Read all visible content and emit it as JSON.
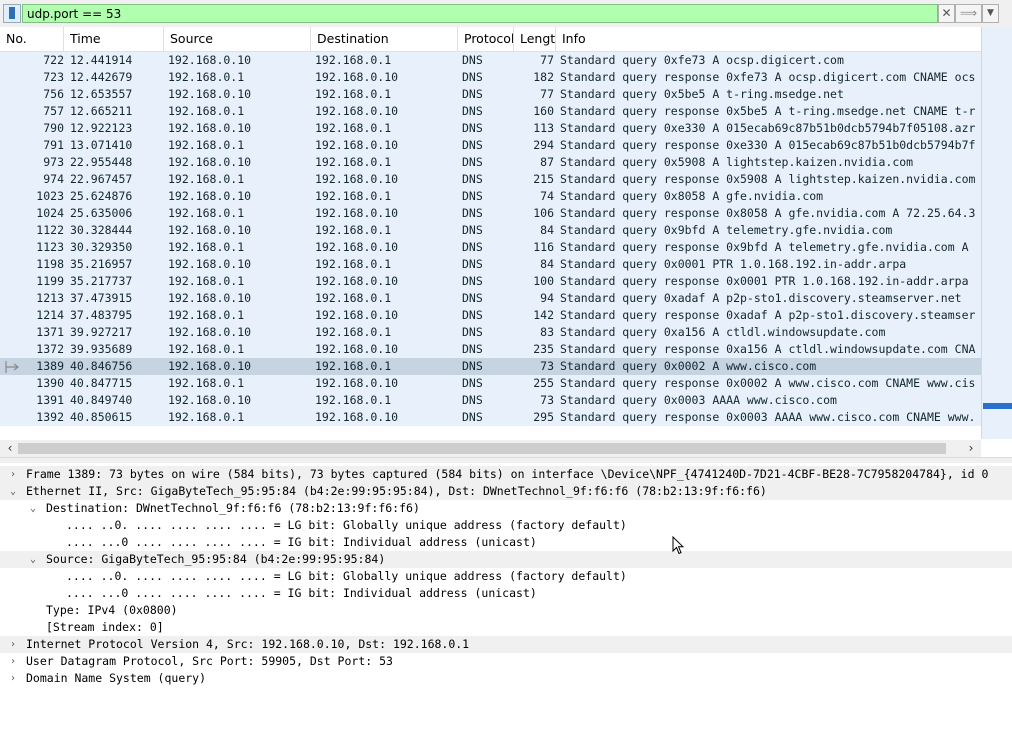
{
  "filter": {
    "value": "udp.port == 53",
    "clear_glyph": "✕",
    "apply_glyph": "⟹",
    "recent_glyph": "▼"
  },
  "packet_list": {
    "columns": [
      "No.",
      "Time",
      "Source",
      "Destination",
      "Protocol",
      "Lengtl",
      "Info"
    ],
    "selected_no": "1389",
    "rows": [
      {
        "no": "722",
        "time": "12.441914",
        "src": "192.168.0.10",
        "dst": "192.168.0.1",
        "proto": "DNS",
        "len": "77",
        "info": "Standard query 0xfe73 A ocsp.digicert.com"
      },
      {
        "no": "723",
        "time": "12.442679",
        "src": "192.168.0.1",
        "dst": "192.168.0.10",
        "proto": "DNS",
        "len": "182",
        "info": "Standard query response 0xfe73 A ocsp.digicert.com CNAME ocs"
      },
      {
        "no": "756",
        "time": "12.653557",
        "src": "192.168.0.10",
        "dst": "192.168.0.1",
        "proto": "DNS",
        "len": "77",
        "info": "Standard query 0x5be5 A t-ring.msedge.net"
      },
      {
        "no": "757",
        "time": "12.665211",
        "src": "192.168.0.1",
        "dst": "192.168.0.10",
        "proto": "DNS",
        "len": "160",
        "info": "Standard query response 0x5be5 A t-ring.msedge.net CNAME t-r"
      },
      {
        "no": "790",
        "time": "12.922123",
        "src": "192.168.0.10",
        "dst": "192.168.0.1",
        "proto": "DNS",
        "len": "113",
        "info": "Standard query 0xe330 A 015ecab69c87b51b0dcb5794b7f05108.azr"
      },
      {
        "no": "791",
        "time": "13.071410",
        "src": "192.168.0.1",
        "dst": "192.168.0.10",
        "proto": "DNS",
        "len": "294",
        "info": "Standard query response 0xe330 A 015ecab69c87b51b0dcb5794b7f"
      },
      {
        "no": "973",
        "time": "22.955448",
        "src": "192.168.0.10",
        "dst": "192.168.0.1",
        "proto": "DNS",
        "len": "87",
        "info": "Standard query 0x5908 A lightstep.kaizen.nvidia.com"
      },
      {
        "no": "974",
        "time": "22.967457",
        "src": "192.168.0.1",
        "dst": "192.168.0.10",
        "proto": "DNS",
        "len": "215",
        "info": "Standard query response 0x5908 A lightstep.kaizen.nvidia.com"
      },
      {
        "no": "1023",
        "time": "25.624876",
        "src": "192.168.0.10",
        "dst": "192.168.0.1",
        "proto": "DNS",
        "len": "74",
        "info": "Standard query 0x8058 A gfe.nvidia.com"
      },
      {
        "no": "1024",
        "time": "25.635006",
        "src": "192.168.0.1",
        "dst": "192.168.0.10",
        "proto": "DNS",
        "len": "106",
        "info": "Standard query response 0x8058 A gfe.nvidia.com A 72.25.64.3"
      },
      {
        "no": "1122",
        "time": "30.328444",
        "src": "192.168.0.10",
        "dst": "192.168.0.1",
        "proto": "DNS",
        "len": "84",
        "info": "Standard query 0x9bfd A telemetry.gfe.nvidia.com"
      },
      {
        "no": "1123",
        "time": "30.329350",
        "src": "192.168.0.1",
        "dst": "192.168.0.10",
        "proto": "DNS",
        "len": "116",
        "info": "Standard query response 0x9bfd A telemetry.gfe.nvidia.com A"
      },
      {
        "no": "1198",
        "time": "35.216957",
        "src": "192.168.0.10",
        "dst": "192.168.0.1",
        "proto": "DNS",
        "len": "84",
        "info": "Standard query 0x0001 PTR 1.0.168.192.in-addr.arpa"
      },
      {
        "no": "1199",
        "time": "35.217737",
        "src": "192.168.0.1",
        "dst": "192.168.0.10",
        "proto": "DNS",
        "len": "100",
        "info": "Standard query response 0x0001 PTR 1.0.168.192.in-addr.arpa"
      },
      {
        "no": "1213",
        "time": "37.473915",
        "src": "192.168.0.10",
        "dst": "192.168.0.1",
        "proto": "DNS",
        "len": "94",
        "info": "Standard query 0xadaf A p2p-sto1.discovery.steamserver.net"
      },
      {
        "no": "1214",
        "time": "37.483795",
        "src": "192.168.0.1",
        "dst": "192.168.0.10",
        "proto": "DNS",
        "len": "142",
        "info": "Standard query response 0xadaf A p2p-sto1.discovery.steamser"
      },
      {
        "no": "1371",
        "time": "39.927217",
        "src": "192.168.0.10",
        "dst": "192.168.0.1",
        "proto": "DNS",
        "len": "83",
        "info": "Standard query 0xa156 A ctldl.windowsupdate.com"
      },
      {
        "no": "1372",
        "time": "39.935689",
        "src": "192.168.0.1",
        "dst": "192.168.0.10",
        "proto": "DNS",
        "len": "235",
        "info": "Standard query response 0xa156 A ctldl.windowsupdate.com CNA"
      },
      {
        "no": "1389",
        "time": "40.846756",
        "src": "192.168.0.10",
        "dst": "192.168.0.1",
        "proto": "DNS",
        "len": "73",
        "info": "Standard query 0x0002 A www.cisco.com"
      },
      {
        "no": "1390",
        "time": "40.847715",
        "src": "192.168.0.1",
        "dst": "192.168.0.10",
        "proto": "DNS",
        "len": "255",
        "info": "Standard query response 0x0002 A www.cisco.com CNAME www.cis"
      },
      {
        "no": "1391",
        "time": "40.849740",
        "src": "192.168.0.10",
        "dst": "192.168.0.1",
        "proto": "DNS",
        "len": "73",
        "info": "Standard query 0x0003 AAAA www.cisco.com"
      },
      {
        "no": "1392",
        "time": "40.850615",
        "src": "192.168.0.1",
        "dst": "192.168.0.10",
        "proto": "DNS",
        "len": "295",
        "info": "Standard query response 0x0003 AAAA www.cisco.com CNAME www."
      }
    ]
  },
  "details": {
    "lines": [
      {
        "level": 0,
        "arrow": "›",
        "band": true,
        "text": "Frame 1389: 73 bytes on wire (584 bits), 73 bytes captured (584 bits) on interface \\Device\\NPF_{4741240D-7D21-4CBF-BE28-7C7958204784}, id 0"
      },
      {
        "level": 0,
        "arrow": "⌄",
        "band": true,
        "text": "Ethernet II, Src: GigaByteTech_95:95:84 (b4:2e:99:95:95:84), Dst: DWnetTechnol_9f:f6:f6 (78:b2:13:9f:f6:f6)"
      },
      {
        "level": 1,
        "arrow": "⌄",
        "band": false,
        "text": "Destination: DWnetTechnol_9f:f6:f6 (78:b2:13:9f:f6:f6)"
      },
      {
        "level": 2,
        "arrow": "",
        "band": false,
        "text": ".... ..0. .... .... .... .... = LG bit: Globally unique address (factory default)"
      },
      {
        "level": 2,
        "arrow": "",
        "band": false,
        "text": ".... ...0 .... .... .... .... = IG bit: Individual address (unicast)"
      },
      {
        "level": 1,
        "arrow": "⌄",
        "band": true,
        "text": "Source: GigaByteTech_95:95:84 (b4:2e:99:95:95:84)"
      },
      {
        "level": 2,
        "arrow": "",
        "band": false,
        "text": ".... ..0. .... .... .... .... = LG bit: Globally unique address (factory default)"
      },
      {
        "level": 2,
        "arrow": "",
        "band": false,
        "text": ".... ...0 .... .... .... .... = IG bit: Individual address (unicast)"
      },
      {
        "level": 1,
        "arrow": "",
        "band": false,
        "text": "Type: IPv4 (0x0800)"
      },
      {
        "level": 1,
        "arrow": "",
        "band": false,
        "text": "[Stream index: 0]"
      },
      {
        "level": 0,
        "arrow": "›",
        "band": true,
        "text": "Internet Protocol Version 4, Src: 192.168.0.10, Dst: 192.168.0.1"
      },
      {
        "level": 0,
        "arrow": "›",
        "band": false,
        "text": "User Datagram Protocol, Src Port: 59905, Dst Port: 53"
      },
      {
        "level": 0,
        "arrow": "›",
        "band": false,
        "text": "Domain Name System (query)"
      }
    ]
  },
  "colors": {
    "row_bg": "#e7f0fb",
    "selected_bg": "#c6d3e1",
    "filter_valid_bg": "#afffaf",
    "minimap_mark": "#2a6fcd"
  }
}
